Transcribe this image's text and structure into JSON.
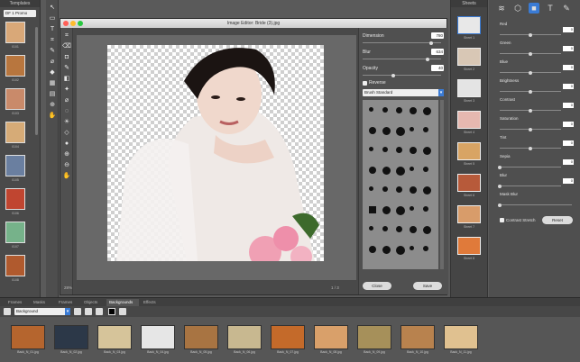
{
  "templates": {
    "header": "Templates",
    "dropdown": "DF 1 Promo",
    "items": [
      {
        "label": "0101",
        "color": "#d9a878"
      },
      {
        "label": "0102",
        "color": "#b8763e"
      },
      {
        "label": "0103",
        "color": "#c98a6a"
      },
      {
        "label": "0104",
        "color": "#d6ab77"
      },
      {
        "label": "0105",
        "color": "#6a7fa0"
      },
      {
        "label": "0106",
        "color": "#c04530"
      },
      {
        "label": "0107",
        "color": "#76b28a"
      },
      {
        "label": "0108",
        "color": "#b05a2e"
      }
    ]
  },
  "editor": {
    "title": "Image Editor: Bride (3).jpg",
    "zoom": "28%",
    "page": "1 / 3",
    "dimension_label": "Dimension",
    "dimension_value": "780",
    "dimension_level": 0.9,
    "blur_label": "Blur",
    "blur_value": "634",
    "blur_level": 0.86,
    "opacity_label": "Opacity",
    "opacity_value": "40",
    "opacity_level": 0.4,
    "reverse_label": "Reverse",
    "brush_type": "Brush Standard",
    "close_label": "Close",
    "save_label": "Save"
  },
  "sheets": {
    "header": "Sheets",
    "items": [
      {
        "label": "Sheet 1",
        "color": "#e8e8e8"
      },
      {
        "label": "Sheet 2",
        "color": "#d8c7b5"
      },
      {
        "label": "Sheet 3",
        "color": "#e4e4e4"
      },
      {
        "label": "Sheet 4",
        "color": "#e6b8b0"
      },
      {
        "label": "Sheet 5",
        "color": "#d8a464"
      },
      {
        "label": "Sheet 6",
        "color": "#b75a3a"
      },
      {
        "label": "Sheet 7",
        "color": "#d89c6a"
      },
      {
        "label": "Sheet 8",
        "color": "#e07a3a"
      }
    ]
  },
  "adjustments": {
    "rows": [
      {
        "label": "Red",
        "value": "0",
        "level": 0.5
      },
      {
        "label": "Green",
        "value": "0",
        "level": 0.5
      },
      {
        "label": "Blue",
        "value": "0",
        "level": 0.5
      },
      {
        "label": "Brightness",
        "value": "0",
        "level": 0.5
      },
      {
        "label": "Contrast",
        "value": "0",
        "level": 0.5
      },
      {
        "label": "Saturation",
        "value": "0",
        "level": 0.5
      },
      {
        "label": "Tint",
        "value": "0",
        "level": 0.5
      },
      {
        "label": "Sepia",
        "value": "0",
        "level": 0.0
      },
      {
        "label": "Blur",
        "value": "0",
        "level": 0.0
      },
      {
        "label": "Mask Blur",
        "value": "",
        "level": 0.0
      }
    ],
    "contrast_stretch_label": "Contrast Stretch",
    "reset_label": "Reset"
  },
  "bottom": {
    "tabs": [
      "Frames",
      "Masks",
      "Frames",
      "Objects",
      "Backgrounds",
      "Effects"
    ],
    "active_tab": "Backgrounds",
    "category": "Background",
    "backgrounds": [
      {
        "label": "Back_N_01.jpg",
        "color": "#b5652e"
      },
      {
        "label": "Back_N_02.jpg",
        "color": "#2c3848"
      },
      {
        "label": "Back_N_03.jpg",
        "color": "#d6c49a"
      },
      {
        "label": "Back_N_04.jpg",
        "color": "#e6e6e6"
      },
      {
        "label": "Back_N_05.jpg",
        "color": "#a87442"
      },
      {
        "label": "Back_N_06.jpg",
        "color": "#c8b890"
      },
      {
        "label": "Back_N_07.jpg",
        "color": "#c46a2a"
      },
      {
        "label": "Back_N_08.jpg",
        "color": "#d9a06a"
      },
      {
        "label": "Back_N_09.jpg",
        "color": "#a6905a"
      },
      {
        "label": "Back_N_10.jpg",
        "color": "#b8824e"
      },
      {
        "label": "Back_N_11.jpg",
        "color": "#e0c190"
      }
    ]
  }
}
